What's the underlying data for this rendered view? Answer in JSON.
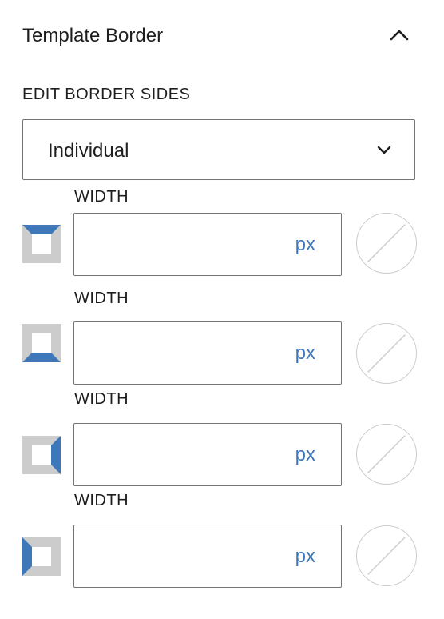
{
  "panel": {
    "title": "Template Border"
  },
  "border_sides": {
    "label": "EDIT BORDER SIDES",
    "selected": "Individual"
  },
  "sides": [
    {
      "side": "top",
      "width_label": "WIDTH",
      "value": "",
      "unit": "px"
    },
    {
      "side": "bottom",
      "width_label": "WIDTH",
      "value": "",
      "unit": "px"
    },
    {
      "side": "right",
      "width_label": "WIDTH",
      "value": "",
      "unit": "px"
    },
    {
      "side": "left",
      "width_label": "WIDTH",
      "value": "",
      "unit": "px"
    }
  ],
  "colors": {
    "accent": "#3f78b8",
    "icon_base": "#cccccc",
    "border": "#757575",
    "swatch_slash": "#cccccc"
  },
  "icons": {
    "collapse": "chevron-up-icon",
    "dropdown": "chevron-down-icon",
    "side_top": "border-top-side-icon",
    "side_bottom": "border-bottom-side-icon",
    "side_right": "border-right-side-icon",
    "side_left": "border-left-side-icon",
    "color": "no-color-swatch-icon"
  }
}
